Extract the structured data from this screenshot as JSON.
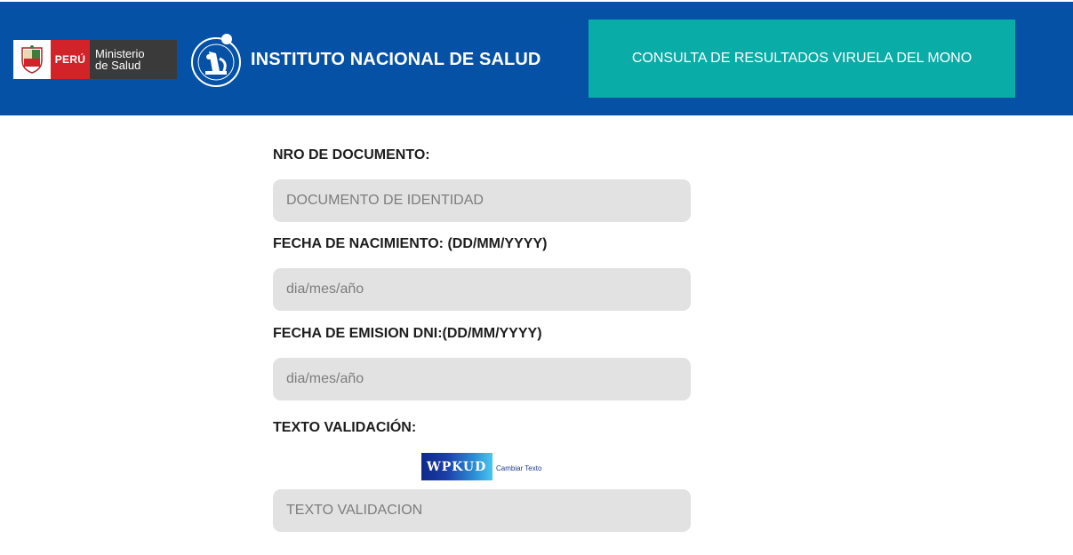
{
  "header": {
    "peru_label": "PERÚ",
    "ministry_line1": "Ministerio",
    "ministry_line2": "de Salud",
    "institute_title": "INSTITUTO NACIONAL DE SALUD",
    "consulta_label": "CONSULTA DE RESULTADOS VIRUELA DEL MONO"
  },
  "form": {
    "document_label": "NRO DE DOCUMENTO:",
    "document_placeholder": "DOCUMENTO DE IDENTIDAD",
    "birth_label": "FECHA DE NACIMIENTO: (DD/MM/YYYY)",
    "birth_placeholder": "dia/mes/año",
    "dni_emission_label": "FECHA DE EMISION DNI:(DD/MM/YYYY)",
    "dni_emission_placeholder": "dia/mes/año",
    "validation_label": "TEXTO VALIDACIÓN:",
    "captcha_text": "WPKUD",
    "change_text_link": "Cambiar Texto",
    "validation_placeholder": "TEXTO VALIDACION"
  },
  "colors": {
    "header_bg": "#0551a6",
    "consulta_bg": "#0aaca8",
    "field_bg": "#e2e2e2",
    "peru_red": "#d3232a"
  }
}
